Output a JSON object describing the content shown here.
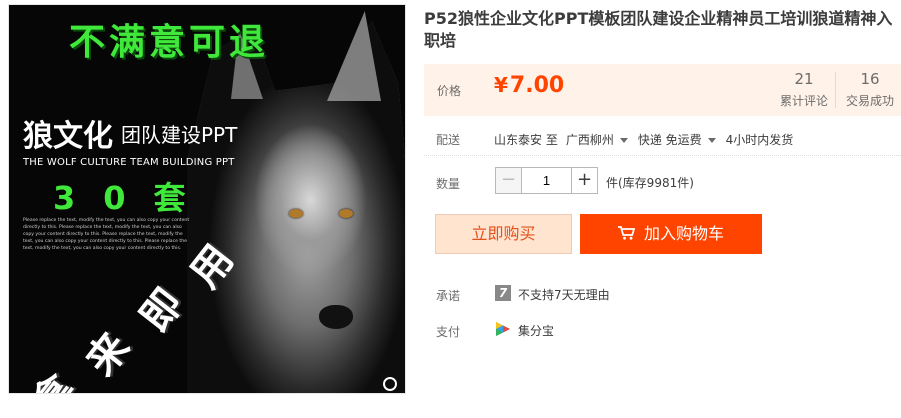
{
  "image": {
    "slogan": "不满意可退",
    "title_big": "狼文化",
    "title_small": "团队建设PPT",
    "subtitle_en": "THE WOLF CULTURE TEAM BUILDING PPT",
    "count": "30套",
    "lorem": "Please replace the text, modify the text, you can also copy your content directly to this. Please replace the text, modify the text, you can also copy your content directly to this. Please replace the text, modify the text, you can also copy your content directly to this. Please replace the text, modify the text, you can also copy your content directly to this.",
    "vertical_text": [
      "拿",
      "来",
      "即",
      "用"
    ]
  },
  "product": {
    "title": "P52狼性企业文化PPT模板团队建设企业精神员工培训狼道精神入职培"
  },
  "price": {
    "label": "价格",
    "currency": "¥",
    "value": "7.00",
    "reviews_count": "21",
    "reviews_label": "累计评论",
    "sales_count": "16",
    "sales_label": "交易成功"
  },
  "shipping": {
    "label": "配送",
    "from": "山东泰安 至",
    "to": "广西柳州",
    "method": "快递 免运费",
    "dispatch": "4小时内发货"
  },
  "quantity": {
    "label": "数量",
    "value": "1",
    "minus": "−",
    "plus": "+",
    "stock": "件(库存9981件)"
  },
  "buttons": {
    "buy_now": "立即购买",
    "add_to_cart": "加入购物车"
  },
  "promise": {
    "label": "承诺",
    "icon_text": "7",
    "text": "不支持7天无理由"
  },
  "payment": {
    "label": "支付",
    "text": "集分宝"
  },
  "colors": {
    "accent": "#ff4400",
    "price_bg": "#fff2e8",
    "green": "#3fe83a"
  }
}
